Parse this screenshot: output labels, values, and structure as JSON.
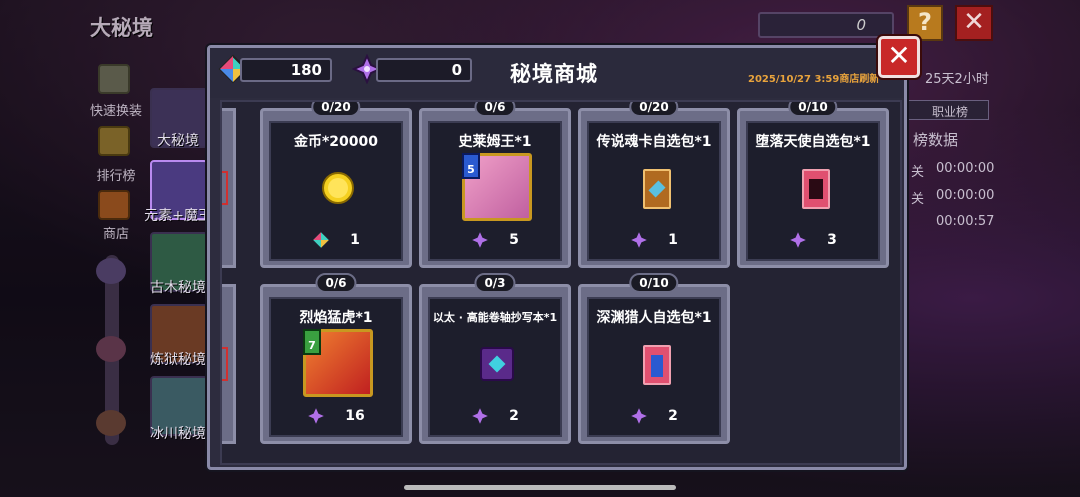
{
  "page": {
    "title": "大秘境"
  },
  "topbar": {
    "input_value": "0"
  },
  "sidebar": {
    "links": [
      {
        "label": "快速换装"
      },
      {
        "label": "排行榜"
      },
      {
        "label": "商店"
      }
    ],
    "tabs": [
      {
        "label": "大秘境"
      },
      {
        "label": "元素+魔王"
      },
      {
        "label": "古木秘境"
      },
      {
        "label": "炼狱秘境"
      },
      {
        "label": "冰川秘境"
      }
    ]
  },
  "right_panel": {
    "countdown": "25天2小时",
    "tab_label": "职业榜",
    "section_title": "榜数据",
    "rows": [
      {
        "prefix": "关",
        "time": "00:00:00"
      },
      {
        "prefix": "关",
        "time": "00:00:00"
      },
      {
        "prefix": "",
        "time": "00:00:57"
      }
    ]
  },
  "shop": {
    "title": "秘境商城",
    "currency_gem": "180",
    "currency_star": "0",
    "refresh_text": "2025/10/27 3:59商店刷新",
    "items": [
      {
        "name": "金币*20000",
        "count": "0/20",
        "price": "1",
        "price_icon": "gem-icon",
        "item_icon": "gold-coin-icon"
      },
      {
        "name": "史莱姆王*1",
        "count": "0/6",
        "price": "5",
        "price_icon": "star-icon",
        "item_icon": "slime-king-icon",
        "level": "5"
      },
      {
        "name": "传说魂卡自选包*1",
        "count": "0/20",
        "price": "1",
        "price_icon": "star-icon",
        "item_icon": "legend-card-pack-icon"
      },
      {
        "name": "堕落天使自选包*1",
        "count": "0/10",
        "price": "3",
        "price_icon": "star-icon",
        "item_icon": "fallen-angel-pack-icon"
      },
      {
        "name": "烈焰猛虎*1",
        "count": "0/6",
        "price": "16",
        "price_icon": "star-icon",
        "item_icon": "flame-tiger-icon",
        "level": "7"
      },
      {
        "name": "以太 · 高能卷轴抄写本*1",
        "count": "0/3",
        "price": "2",
        "price_icon": "star-icon",
        "item_icon": "ether-scroll-icon"
      },
      {
        "name": "深渊猎人自选包*1",
        "count": "0/10",
        "price": "2",
        "price_icon": "star-icon",
        "item_icon": "abyss-hunter-pack-icon"
      }
    ]
  },
  "colors": {
    "accent_orange": "#e8a33c",
    "close_red": "#c82828",
    "card_frame": "#6c6d87"
  }
}
